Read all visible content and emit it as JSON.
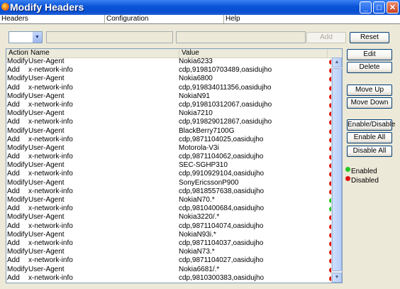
{
  "window": {
    "title": "Modify Headers",
    "minimize": "_",
    "maximize": "□",
    "close": "✕"
  },
  "menu": [
    "Headers",
    "Configuration",
    "Help"
  ],
  "toolbar": {
    "action_value": "",
    "name_value": "",
    "value_value": "",
    "add": "Add",
    "reset": "Reset"
  },
  "table": {
    "columns": [
      "Action",
      "Name",
      "Value"
    ],
    "rows": [
      {
        "action": "Modify",
        "name": "User-Agent",
        "value": "Nokia6233",
        "enabled": false
      },
      {
        "action": "Add",
        "name": "x-network-info",
        "value": "cdp,919810703489,oasidujho",
        "enabled": false
      },
      {
        "action": "Modify",
        "name": "User-Agent",
        "value": "Nokia6800",
        "enabled": false
      },
      {
        "action": "Add",
        "name": "x-network-info",
        "value": "cdp,919834011356,oasidujho",
        "enabled": false
      },
      {
        "action": "Modify",
        "name": "User-Agent",
        "value": "NokiaN91",
        "enabled": false
      },
      {
        "action": "Add",
        "name": "x-network-info",
        "value": "cdp,919810312067,oasidujho",
        "enabled": false
      },
      {
        "action": "Modify",
        "name": "User-Agent",
        "value": "Nokia7210",
        "enabled": false
      },
      {
        "action": "Add",
        "name": "x-network-info",
        "value": "cdp,919829012867,oasidujho",
        "enabled": false
      },
      {
        "action": "Modify",
        "name": "User-Agent",
        "value": "BlackBerry7100G",
        "enabled": false
      },
      {
        "action": "Add",
        "name": "x-network-info",
        "value": "cdp,9871104025,oasidujho",
        "enabled": false
      },
      {
        "action": "Modify",
        "name": "User-Agent",
        "value": "Motorola-V3i",
        "enabled": false
      },
      {
        "action": "Add",
        "name": "x-network-info",
        "value": "cdp,9871104062,oasidujho",
        "enabled": false
      },
      {
        "action": "Modify",
        "name": "User-Agent",
        "value": "SEC-SGHP310",
        "enabled": false
      },
      {
        "action": "Add",
        "name": "x-network-info",
        "value": "cdp,9910929104,oasidujho",
        "enabled": false
      },
      {
        "action": "Modify",
        "name": "User-Agent",
        "value": "SonyEricssonP900",
        "enabled": false
      },
      {
        "action": "Add",
        "name": "x-network-info",
        "value": "cdp,9818557638,oasidujho",
        "enabled": false
      },
      {
        "action": "Modify",
        "name": "User-Agent",
        "value": "NokiaN70.*",
        "enabled": true
      },
      {
        "action": "Add",
        "name": "x-network-info",
        "value": "cdp,9810400684,oasidujho",
        "enabled": true
      },
      {
        "action": "Modify",
        "name": "User-Agent",
        "value": "Nokia3220/.*",
        "enabled": false
      },
      {
        "action": "Add",
        "name": "x-network-info",
        "value": "cdp,9871104074,oasidujho",
        "enabled": false
      },
      {
        "action": "Modify",
        "name": "User-Agent",
        "value": "NokiaN93i.*",
        "enabled": false
      },
      {
        "action": "Add",
        "name": "x-network-info",
        "value": "cdp,9871104037,oasidujho",
        "enabled": false
      },
      {
        "action": "Modify",
        "name": "User-Agent",
        "value": "NokiaN73.*",
        "enabled": false
      },
      {
        "action": "Add",
        "name": "x-network-info",
        "value": "cdp,9871104027,oasidujho",
        "enabled": false
      },
      {
        "action": "Modify",
        "name": "User-Agent",
        "value": "Nokia6681/.*",
        "enabled": false
      },
      {
        "action": "Add",
        "name": "x-network-info",
        "value": "cdp,9810300383,oasidujho",
        "enabled": false
      }
    ]
  },
  "buttons": {
    "edit": "Edit",
    "delete": "Delete",
    "move_up": "Move Up",
    "move_down": "Move Down",
    "enable_disable": "Enable/Disable",
    "enable_all": "Enable All",
    "disable_all": "Disable All"
  },
  "legend": {
    "enabled": "Enabled",
    "disabled": "Disabled"
  },
  "colors": {
    "enabled": "#22c722",
    "disabled": "#dd1010"
  },
  "scroll": {
    "up": "▲",
    "down": "▼",
    "combo": "▼"
  }
}
